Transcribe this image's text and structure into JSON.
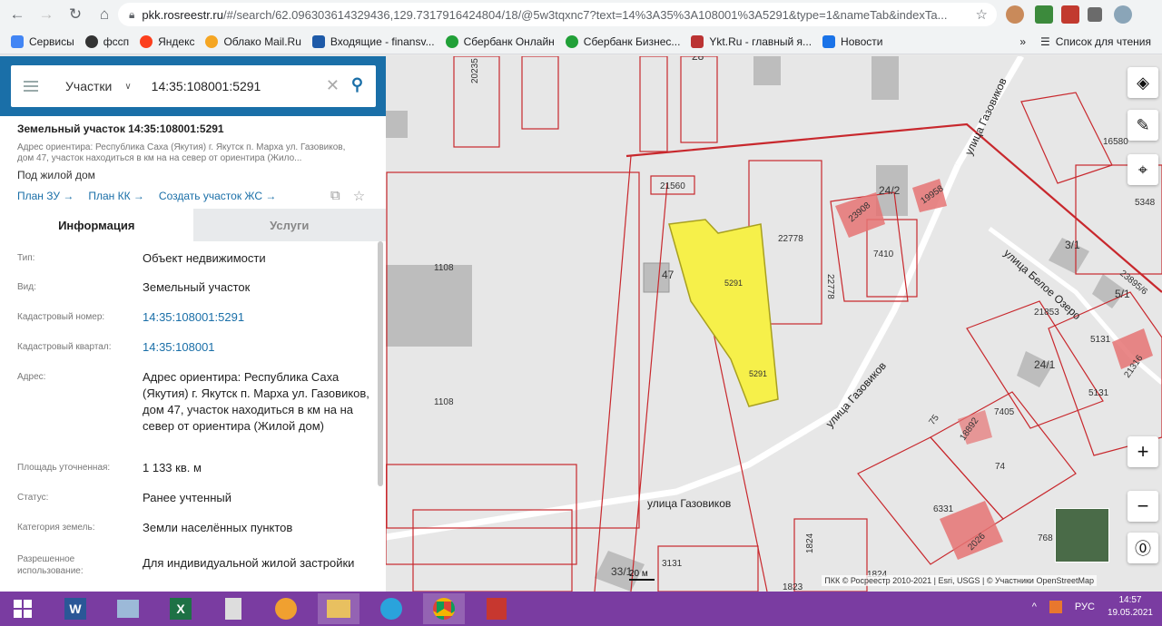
{
  "browser": {
    "url_host": "pkk.rosreestr.ru",
    "url_rest": "/#/search/62.096303614329436,129.7317916424804/18/@5w3tqxnc7?text=14%3A35%3A108001%3A5291&type=1&nameTab&indexTa..."
  },
  "bookmarks": {
    "items": [
      "Сервисы",
      "фссп",
      "Яндекс",
      "Облако Mail.Ru",
      "Входящие - finansv...",
      "Сбербанк Онлайн",
      "Сбербанк Бизнес...",
      "Ykt.Ru - главный я...",
      "Новости"
    ],
    "reading_list": "Список для чтения"
  },
  "search": {
    "type_label": "Участки",
    "query": "14:35:108001:5291"
  },
  "object": {
    "title": "Земельный участок 14:35:108001:5291",
    "address_short": "Адрес ориентира: Республика Саха (Якутия) г. Якутск п. Марха ул. Газовиков, дом 47, участок находиться в км на на север от ориентира (Жило...",
    "use": "Под жилой дом",
    "link_plan_zu": "План ЗУ →",
    "link_plan_kk": "План КК →",
    "link_create": "Создать участок ЖС →"
  },
  "tabs": {
    "info": "Информация",
    "services": "Услуги"
  },
  "rows": [
    {
      "label": "Тип:",
      "value": "Объект недвижимости"
    },
    {
      "label": "Вид:",
      "value": "Земельный участок"
    },
    {
      "label": "Кадастровый номер:",
      "value": "14:35:108001:5291"
    },
    {
      "label": "Кадастровый квартал:",
      "value": "14:35:108001"
    },
    {
      "label": "Адрес:",
      "value": "Адрес ориентира: Республика Саха (Якутия) г. Якутск п. Марха ул. Газовиков, дом 47, участок находиться в км на на север от ориентира (Жилой дом)"
    },
    {
      "label": "Площадь уточненная:",
      "value": "1 133 кв. м"
    },
    {
      "label": "Статус:",
      "value": "Ранее учтенный"
    },
    {
      "label": "Категория земель:",
      "value": "Земли населённых пунктов"
    },
    {
      "label": "Разрешенное использование:",
      "value": "Для индивидуальной жилой застройки"
    }
  ],
  "map": {
    "labels": {
      "l1108a": "1108",
      "l1108b": "1108",
      "l47": "47",
      "l21560": "21560",
      "l5291a": "5291",
      "l5291b": "5291",
      "l22778a": "22778",
      "l22778b": "22778",
      "l7410": "7410",
      "l23908": "23908",
      "l24_2": "24/2",
      "l19958": "19958",
      "l16580": "16580",
      "l5348": "5348",
      "l3_1": "3/1",
      "l5_1": "5/1",
      "l23895": "23895/6",
      "l21853": "21853",
      "l5131a": "5131",
      "l5131b": "5131",
      "l24_1": "24/1",
      "l21316": "21316",
      "l7405": "7405",
      "l75": "75",
      "l18892": "18892",
      "l74": "74",
      "l6331": "6331",
      "l2026": "2026",
      "l768": "768",
      "l3131": "3131",
      "l33_1": "33/1",
      "l1824": "1824",
      "l1823": "1823",
      "l20235": "20235",
      "l28": "28",
      "l1824b": "1824"
    },
    "streets": {
      "gazovikov1": "улица Газовиков",
      "gazovikov2": "улица Газовиков",
      "gazovikov3": "улица Газовиков",
      "beloe": "улица Белое Озеро"
    },
    "attribution": "ПКК © Росреестр 2010-2021 | Esri, USGS | © Участники OpenStreetMap",
    "scale": "20 м"
  },
  "taskbar": {
    "lang": "РУС",
    "time": "14:57",
    "date": "19.05.2021"
  }
}
